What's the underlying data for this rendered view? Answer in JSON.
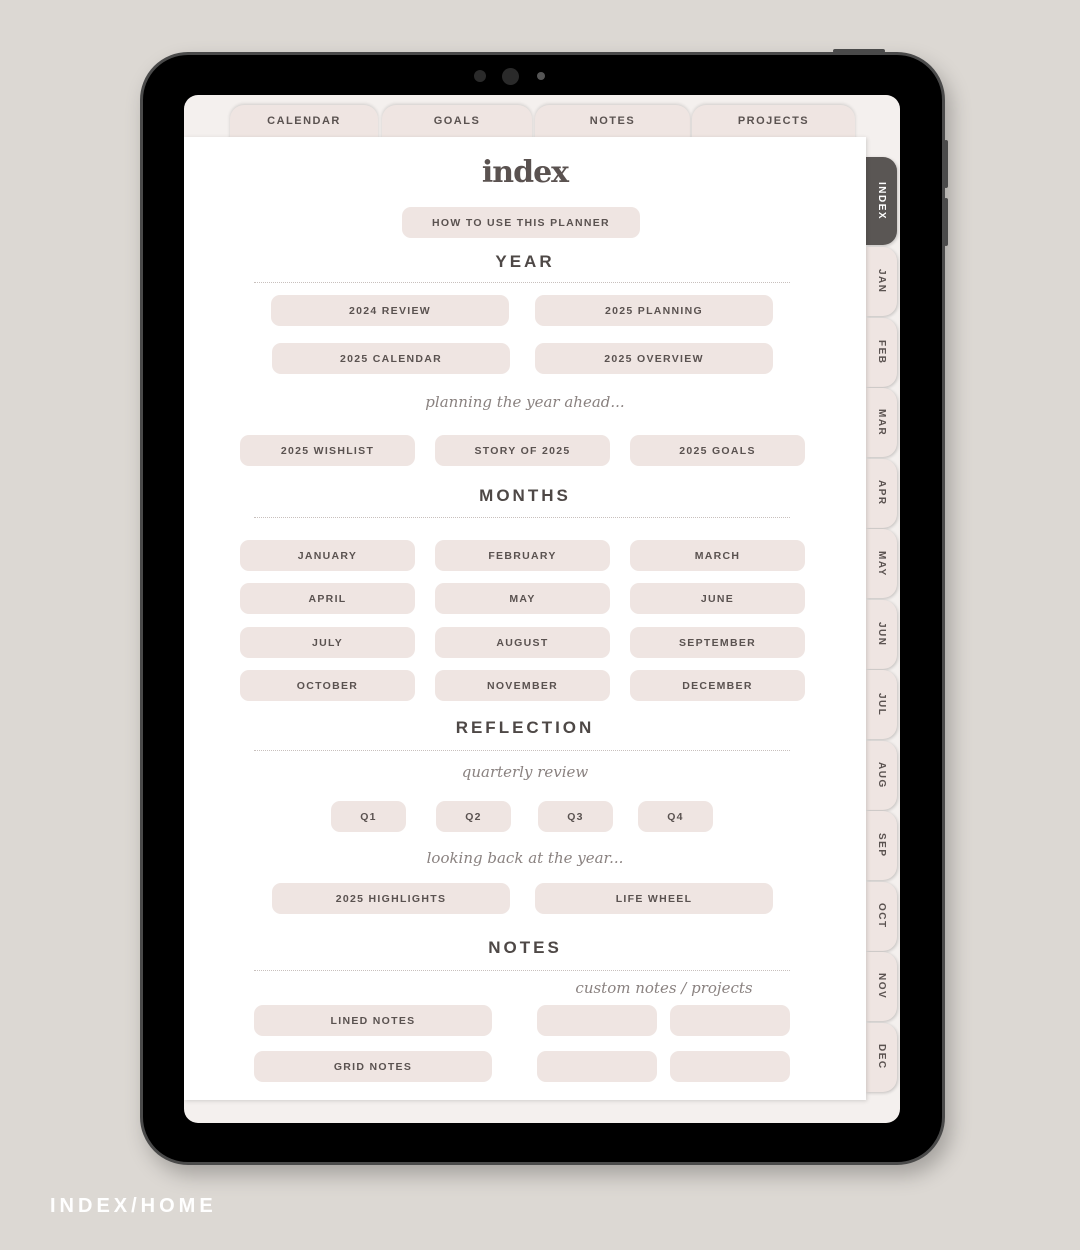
{
  "top_tabs": [
    "CALENDAR",
    "GOALS",
    "NOTES",
    "PROJECTS"
  ],
  "side_tabs": [
    "INDEX",
    "JAN",
    "FEB",
    "MAR",
    "APR",
    "MAY",
    "JUN",
    "JUL",
    "AUG",
    "SEP",
    "OCT",
    "NOV",
    "DEC"
  ],
  "active_side_tab": "INDEX",
  "title": "index",
  "how_to": "HOW TO USE THIS PLANNER",
  "year": {
    "heading": "YEAR",
    "buttons": [
      "2024 REVIEW",
      "2025 PLANNING",
      "2025 CALENDAR",
      "2025 OVERVIEW"
    ],
    "script": "planning the year ahead...",
    "buttons2": [
      "2025 WISHLIST",
      "STORY OF 2025",
      "2025 GOALS"
    ]
  },
  "months": {
    "heading": "MONTHS",
    "items": [
      "JANUARY",
      "FEBRUARY",
      "MARCH",
      "APRIL",
      "MAY",
      "JUNE",
      "JULY",
      "AUGUST",
      "SEPTEMBER",
      "OCTOBER",
      "NOVEMBER",
      "DECEMBER"
    ]
  },
  "reflection": {
    "heading": "REFLECTION",
    "script": "quarterly review",
    "quarters": [
      "Q1",
      "Q2",
      "Q3",
      "Q4"
    ],
    "script2": "looking back at the year...",
    "buttons": [
      "2025 HIGHLIGHTS",
      "LIFE WHEEL"
    ]
  },
  "notes": {
    "heading": "NOTES",
    "script": "custom notes / projects",
    "buttons": [
      "LINED NOTES",
      "GRID NOTES"
    ]
  },
  "caption": "INDEX/HOME",
  "colors": {
    "button_bg": "#efe5e2",
    "active_tab": "#5a5654",
    "text": "#5a5250",
    "background": "#dcd8d3"
  }
}
